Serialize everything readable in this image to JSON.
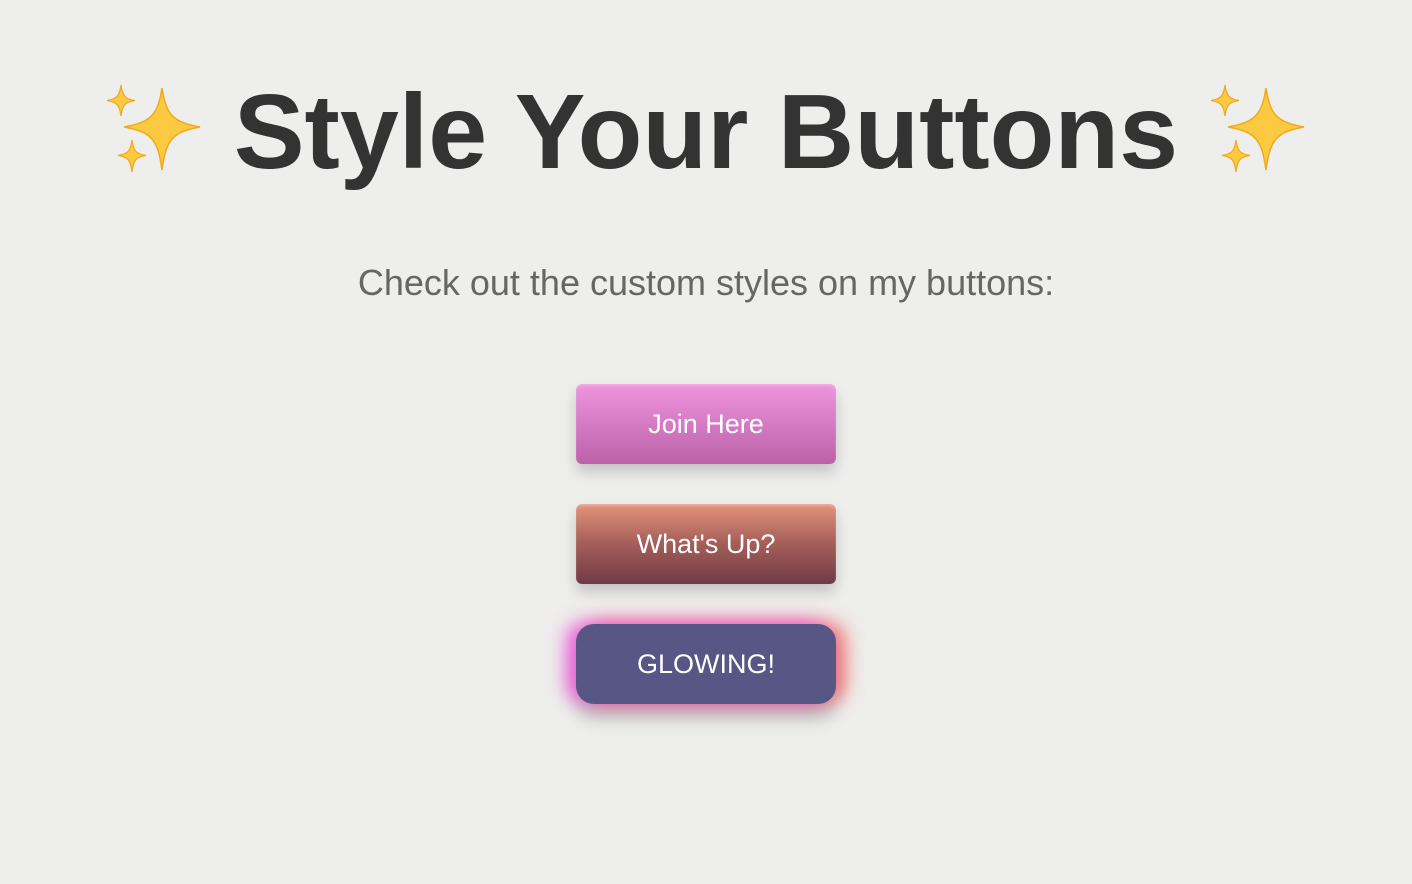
{
  "header": {
    "title": "Style Your Buttons",
    "sparkle_icon": "sparkles-icon"
  },
  "intro": {
    "text": "Check out the custom styles on my buttons:"
  },
  "buttons": [
    {
      "label": "Join Here",
      "style": "pink-gradient",
      "colors": [
        "#ee95dc",
        "#bb62a8"
      ]
    },
    {
      "label": "What's Up?",
      "style": "sunset-gradient",
      "colors": [
        "#e3937b",
        "#703a47"
      ]
    },
    {
      "label": "GLOWING!",
      "style": "glow",
      "colors": [
        "#575685",
        "#eb50dc",
        "#f55a5a"
      ]
    }
  ],
  "colors": {
    "background": "#eeeeec",
    "title": "#333333",
    "subtitle": "#666666"
  }
}
